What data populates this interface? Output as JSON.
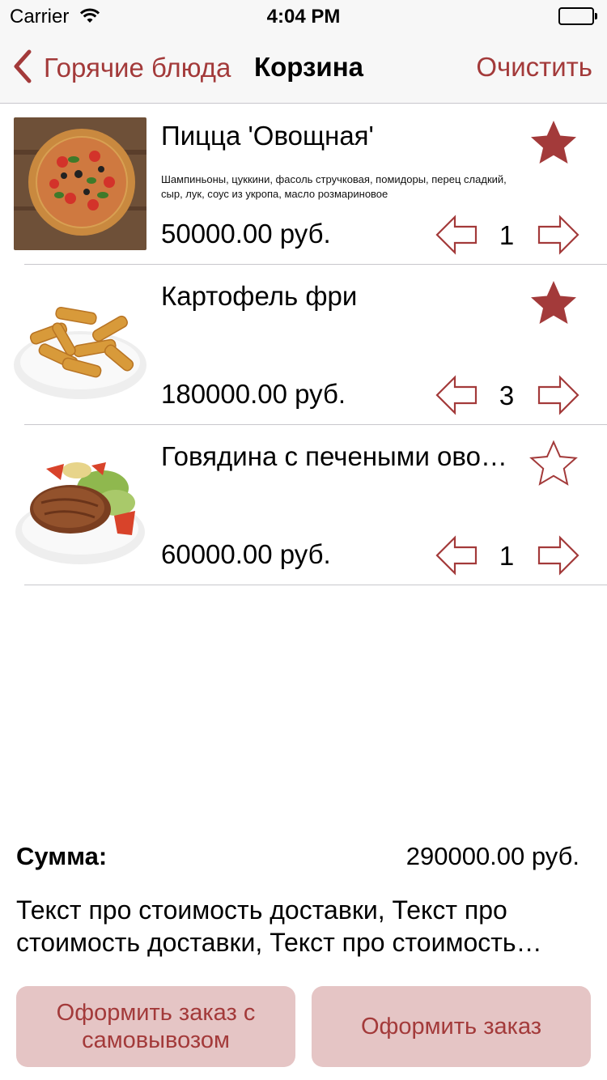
{
  "status_bar": {
    "carrier": "Carrier",
    "time": "4:04 PM"
  },
  "nav": {
    "back_label": "Горячие блюда",
    "title": "Корзина",
    "clear_label": "Очистить"
  },
  "items": [
    {
      "name": "Пицца 'Овощная'",
      "description": "Шампиньоны, цуккини, фасоль стручковая, помидоры,   перец сладкий, сыр, лук, соус из укропа, масло розмариновое",
      "price": "50000.00 руб.",
      "quantity": "1",
      "favorite": true,
      "image": "pizza"
    },
    {
      "name": "Картофель фри",
      "description": "",
      "price": "180000.00 руб.",
      "quantity": "3",
      "favorite": true,
      "image": "fries"
    },
    {
      "name": "Говядина с печеными овощами",
      "description": "",
      "price": "60000.00 руб.",
      "quantity": "1",
      "favorite": false,
      "image": "beef"
    }
  ],
  "summary": {
    "sum_label": "Сумма:",
    "sum_value": "290000.00 руб.",
    "delivery_text": "Текст про стоимость доставки, Текст про стоимость доставки, Текст про стоимость доставки"
  },
  "buttons": {
    "pickup_label": "Оформить заказ с самовывозом",
    "order_label": "Оформить заказ"
  },
  "colors": {
    "accent": "#a33a3a",
    "button_bg": "#e5c5c5",
    "bar_bg": "#f7f7f7",
    "separator": "#c8c7cc"
  },
  "icons": {
    "back": "chevron-left-icon",
    "favorite_on": "star-filled-icon",
    "favorite_off": "star-outline-icon",
    "decrease": "arrow-left-outline-icon",
    "increase": "arrow-right-outline-icon"
  }
}
